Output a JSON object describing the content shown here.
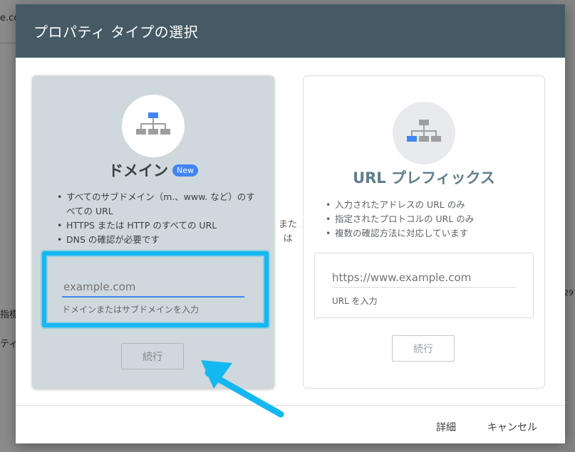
{
  "background": {
    "fragment_top": "e.co",
    "fragment_mid": "指標",
    "fragment_low": "ティ",
    "fragment_right": "29"
  },
  "dialog": {
    "title": "プロパティ タイプの選択",
    "or_label": "また\nは",
    "footer": {
      "detail_label": "詳細",
      "cancel_label": "キャンセル"
    }
  },
  "domain_card": {
    "title": "ドメイン",
    "badge": "New",
    "features": [
      "すべてのサブドメイン（m.、www. など）のすべての URL",
      "HTTPS または HTTP のすべての URL",
      "DNS の確認が必要です"
    ],
    "input_placeholder": "example.com",
    "input_hint": "ドメインまたはサブドメインを入力",
    "continue_label": "続行"
  },
  "url_card": {
    "title": "URL プレフィックス",
    "features": [
      "入力されたアドレスの URL のみ",
      "指定されたプロトコルの URL のみ",
      "複数の確認方法に対応しています"
    ],
    "input_placeholder": "https://www.example.com",
    "input_hint": "URL を入力",
    "continue_label": "続行"
  },
  "colors": {
    "header_bg": "#455a64",
    "domain_card_bg": "#cfd8dc",
    "accent": "#4285f4",
    "highlight": "#14b8f0"
  }
}
